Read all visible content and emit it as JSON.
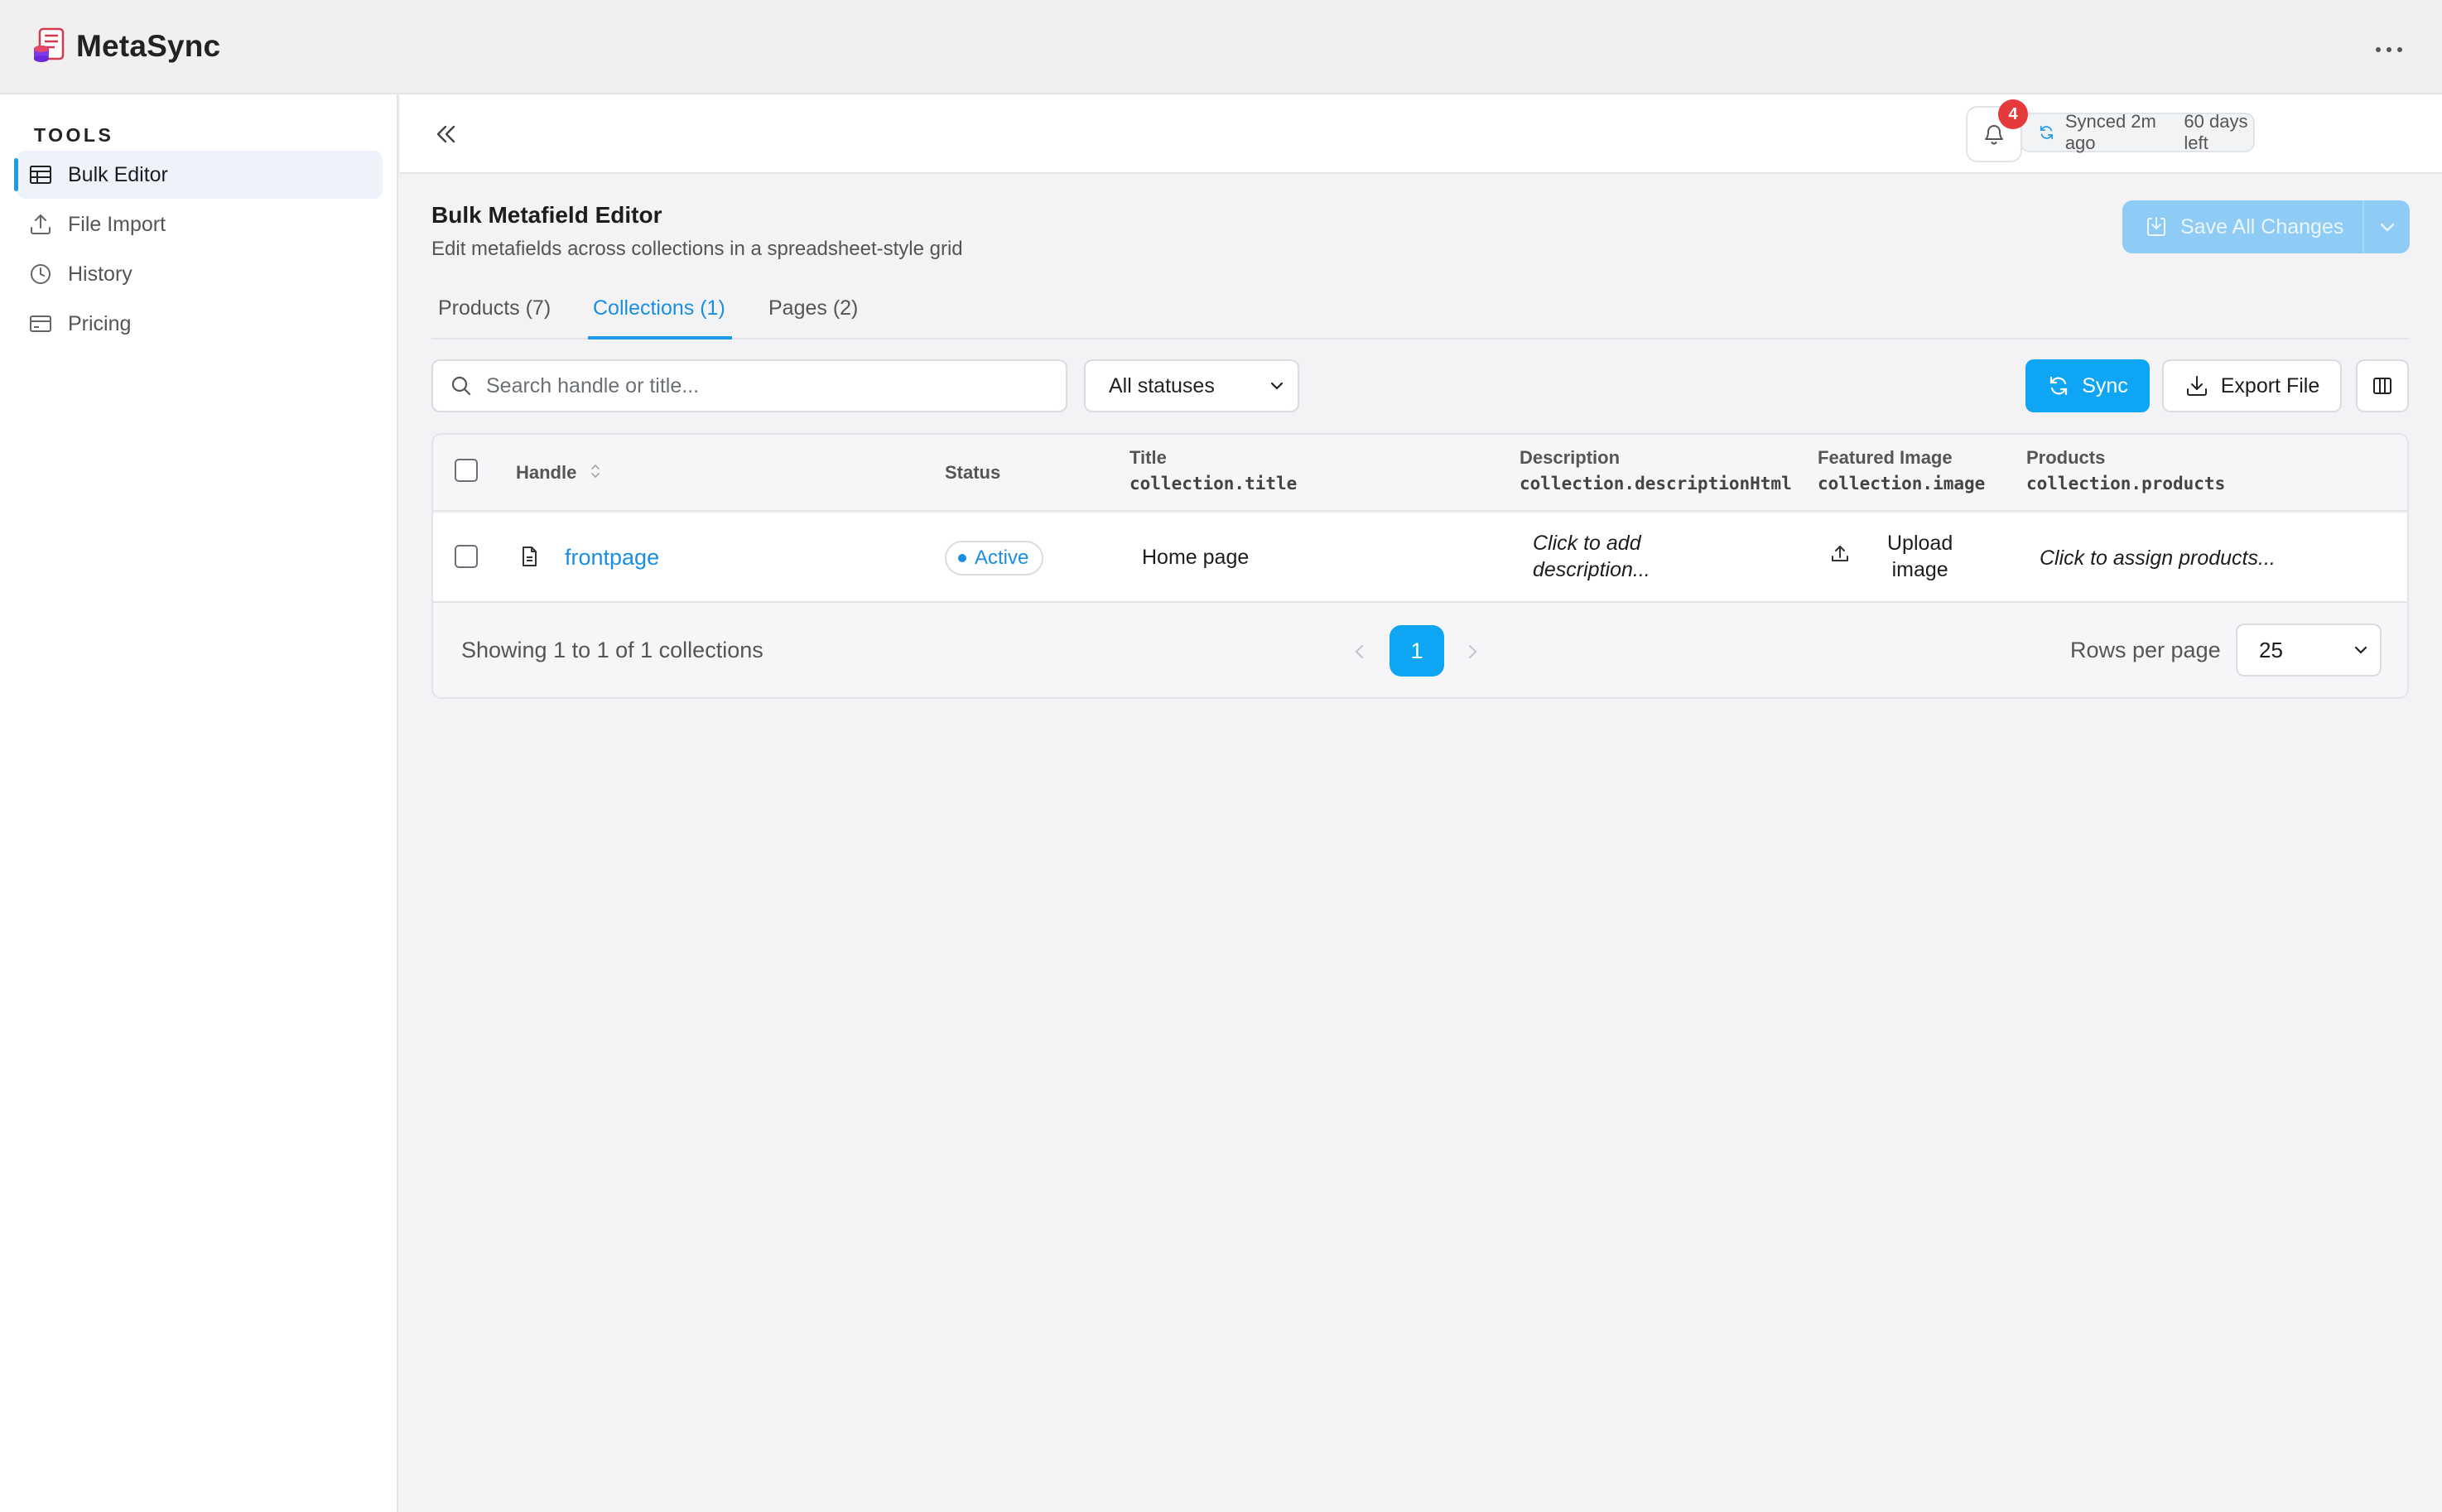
{
  "app": {
    "title": "MetaSync"
  },
  "sidebar": {
    "section_label": "TOOLS",
    "items": [
      {
        "label": "Bulk Editor",
        "icon": "table-icon",
        "active": true
      },
      {
        "label": "File Import",
        "icon": "upload-icon",
        "active": false
      },
      {
        "label": "History",
        "icon": "clock-icon",
        "active": false
      },
      {
        "label": "Pricing",
        "icon": "credit-card-icon",
        "active": false
      }
    ]
  },
  "header": {
    "sync_status": "Synced 2m ago",
    "trial": "60 days left",
    "notification_count": "4"
  },
  "page": {
    "title": "Bulk Metafield Editor",
    "subtitle": "Edit metafields across collections in a spreadsheet-style grid",
    "save_label": "Save All Changes"
  },
  "tabs": [
    {
      "label": "Products (7)",
      "active": false
    },
    {
      "label": "Collections (1)",
      "active": true
    },
    {
      "label": "Pages (2)",
      "active": false
    }
  ],
  "toolbar": {
    "search_placeholder": "Search handle or title...",
    "status_filter": "All statuses",
    "sync_label": "Sync",
    "export_label": "Export File"
  },
  "table": {
    "columns": [
      {
        "label": "Handle",
        "field": ""
      },
      {
        "label": "Status",
        "field": ""
      },
      {
        "label": "Title",
        "field": "collection.title"
      },
      {
        "label": "Description",
        "field": "collection.descriptionHtml"
      },
      {
        "label": "Featured Image",
        "field": "collection.image"
      },
      {
        "label": "Products",
        "field": "collection.products"
      }
    ],
    "rows": [
      {
        "handle": "frontpage",
        "status": "Active",
        "title": "Home page",
        "description_line1": "Click to add",
        "description_line2": "description...",
        "image_line1": "Upload",
        "image_line2": "image",
        "products": "Click to assign products..."
      }
    ]
  },
  "pagination": {
    "showing": "Showing 1 to 1 of 1 collections",
    "current_page": "1",
    "rows_label": "Rows per page",
    "rows_per_page": "25"
  },
  "colors": {
    "accent": "#0ea5f5",
    "link": "#1a8fe0",
    "badge": "#e5393b",
    "save_disabled": "#8ecbf5"
  }
}
